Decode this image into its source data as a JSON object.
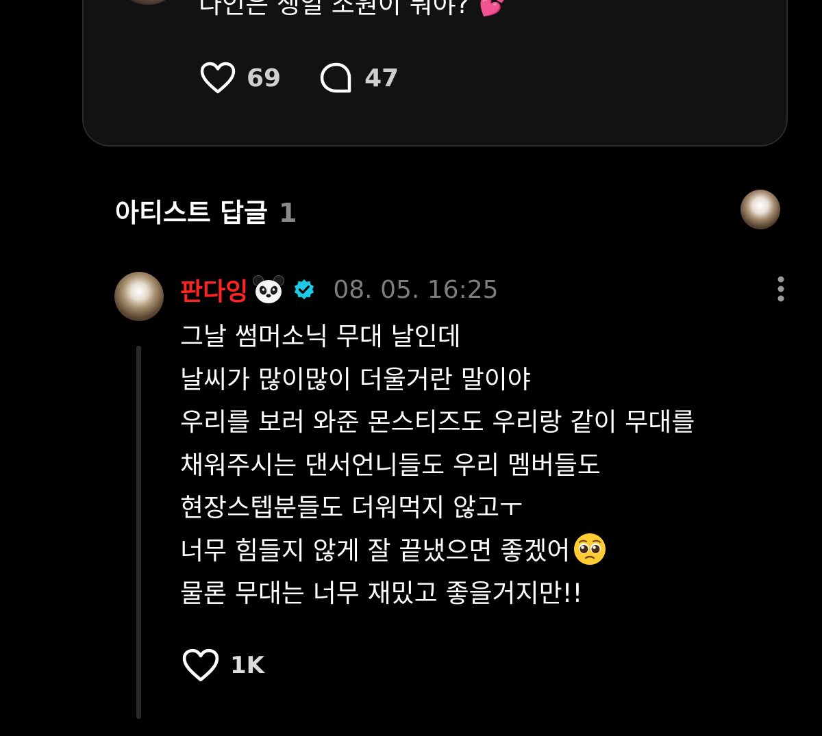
{
  "post": {
    "text": "다인은 생일 소원이 뭐야?",
    "emoji": "💕",
    "like_count": "69",
    "comment_count": "47"
  },
  "section": {
    "title": "아티스트 답글",
    "count": "1"
  },
  "reply": {
    "author": "판다잉",
    "author_emoji": "panda-face-icon",
    "timestamp": "08. 05. 16:25",
    "lines": [
      "그날 썸머소닉 무대 날인데",
      "날씨가 많이많이 더울거란 말이야",
      "우리를 보러 와준 몬스티즈도 우리랑 같이 무대를",
      "채워주시는 댄서언니들도 우리 멤버들도",
      "현장스텝분들도 더워먹지 않고ㅜ",
      "너무 힘들지 않게 잘 끝냈으면 좋겠어",
      "물론 무대는 너무 재밌고 좋을거지만!!"
    ],
    "line6_emoji": "pleading-face-icon",
    "like_count": "1K"
  },
  "colors": {
    "background": "#000000",
    "card": "#121212",
    "author": "#ff2424",
    "verified": "#1ec9e8",
    "muted": "#7e7e7e"
  }
}
